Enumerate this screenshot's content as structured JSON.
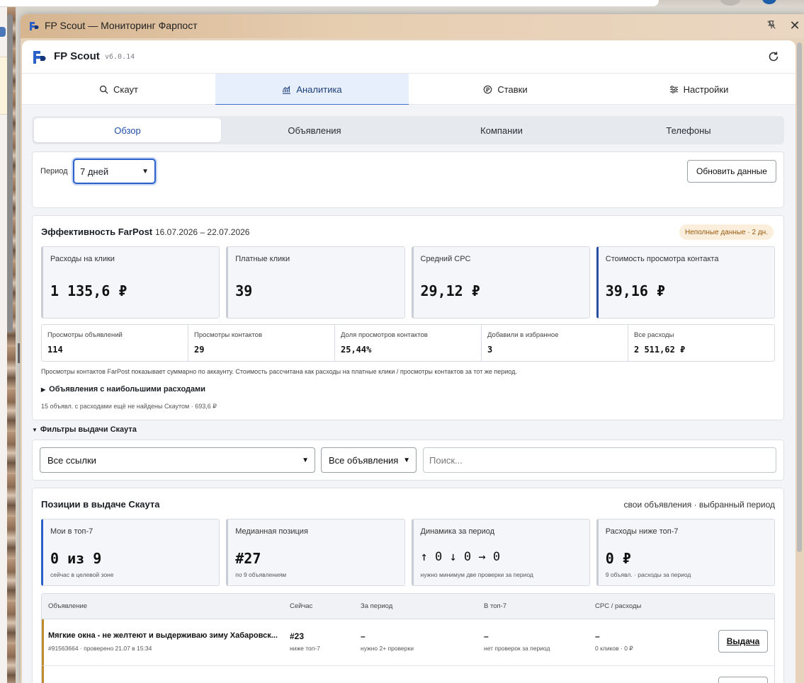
{
  "window": {
    "title": "FP Scout — Мониторинг Фарпост"
  },
  "app": {
    "brand": "FP Scout",
    "version": "v6.0.14"
  },
  "tabs": [
    {
      "label": "Скаут",
      "icon": "search-icon"
    },
    {
      "label": "Аналитика",
      "icon": "chart-icon",
      "active": true
    },
    {
      "label": "Ставки",
      "icon": "coin-icon"
    },
    {
      "label": "Настройки",
      "icon": "sliders-icon"
    }
  ],
  "subtabs": [
    {
      "label": "Обзор",
      "active": true
    },
    {
      "label": "Объявления"
    },
    {
      "label": "Компании"
    },
    {
      "label": "Телефоны"
    }
  ],
  "period": {
    "label": "Период",
    "selected": "7 дней",
    "update_button": "Обновить данные"
  },
  "efficiency": {
    "title": "Эффективность FarPost",
    "range": "16.07.2026 – 22.07.2026",
    "badge": "Неполные данные · 2 дн.",
    "kpis": [
      {
        "label": "Расходы на клики",
        "value": "1 135,6 ₽"
      },
      {
        "label": "Платные клики",
        "value": "39"
      },
      {
        "label": "Средний CPC",
        "value": "29,12 ₽"
      },
      {
        "label": "Стоимость просмотра контакта",
        "value": "39,16 ₽"
      }
    ],
    "metrics": [
      {
        "label": "Просмотры объявлений",
        "value": "114"
      },
      {
        "label": "Просмотры контактов",
        "value": "29"
      },
      {
        "label": "Доля просмотров контактов",
        "value": "25,44%"
      },
      {
        "label": "Добавили в избранное",
        "value": "3"
      },
      {
        "label": "Все расходы",
        "value": "2 511,62 ₽"
      }
    ],
    "note": "Просмотры контактов FarPost показывает суммарно по аккаунту. Стоимость рассчитана как расходы на платные клики / просмотры контактов за тот же период.",
    "details_label": "Объявления с наибольшими расходами",
    "footer": "15 объявл. с расходами ещё не найдены Скаутом · 693,6 ₽"
  },
  "filters": {
    "toggle_label": "Фильтры выдачи Скаута",
    "links_selected": "Все ссылки",
    "ads_selected": "Все объявления",
    "search_placeholder": "Поиск..."
  },
  "positions": {
    "title": "Позиции в выдаче Скаута",
    "subtitle": "свои объявления · выбранный период",
    "kpis": [
      {
        "label": "Мои в топ-7",
        "value": "0 из 9",
        "sub": "сейчас в целевой зоне"
      },
      {
        "label": "Медианная позиция",
        "value": "#27",
        "sub": "по 9 объявлениям"
      },
      {
        "label": "Динамика за период",
        "value": "↑ 0 ↓ 0 → 0",
        "sub": "нужно минимум две проверки за период"
      },
      {
        "label": "Расходы ниже топ-7",
        "value": "0 ₽",
        "sub": "9 объявл. · расходы за период"
      }
    ],
    "table": {
      "headers": [
        "Объявление",
        "Сейчас",
        "За период",
        "В топ-7",
        "CPC / расходы"
      ],
      "rows": [
        {
          "title": "Мягкие окна - не желтеют и выдерживаю зиму Хабаровск...",
          "sub": "#91563664 · проверено 21.07 в 15:34",
          "now": "#23",
          "now_sub": "ниже топ-7",
          "period": "–",
          "period_sub": "нужно 2+ проверки",
          "top7": "–",
          "top7_sub": "нет проверок за период",
          "cpc": "–",
          "cpc_sub": "0 кликов · 0 ₽",
          "button": "Выдача"
        }
      ]
    }
  },
  "colors": {
    "accent": "#2a61c9",
    "warn_bg": "#fbeedc",
    "row_marker": "#c18a2c"
  }
}
